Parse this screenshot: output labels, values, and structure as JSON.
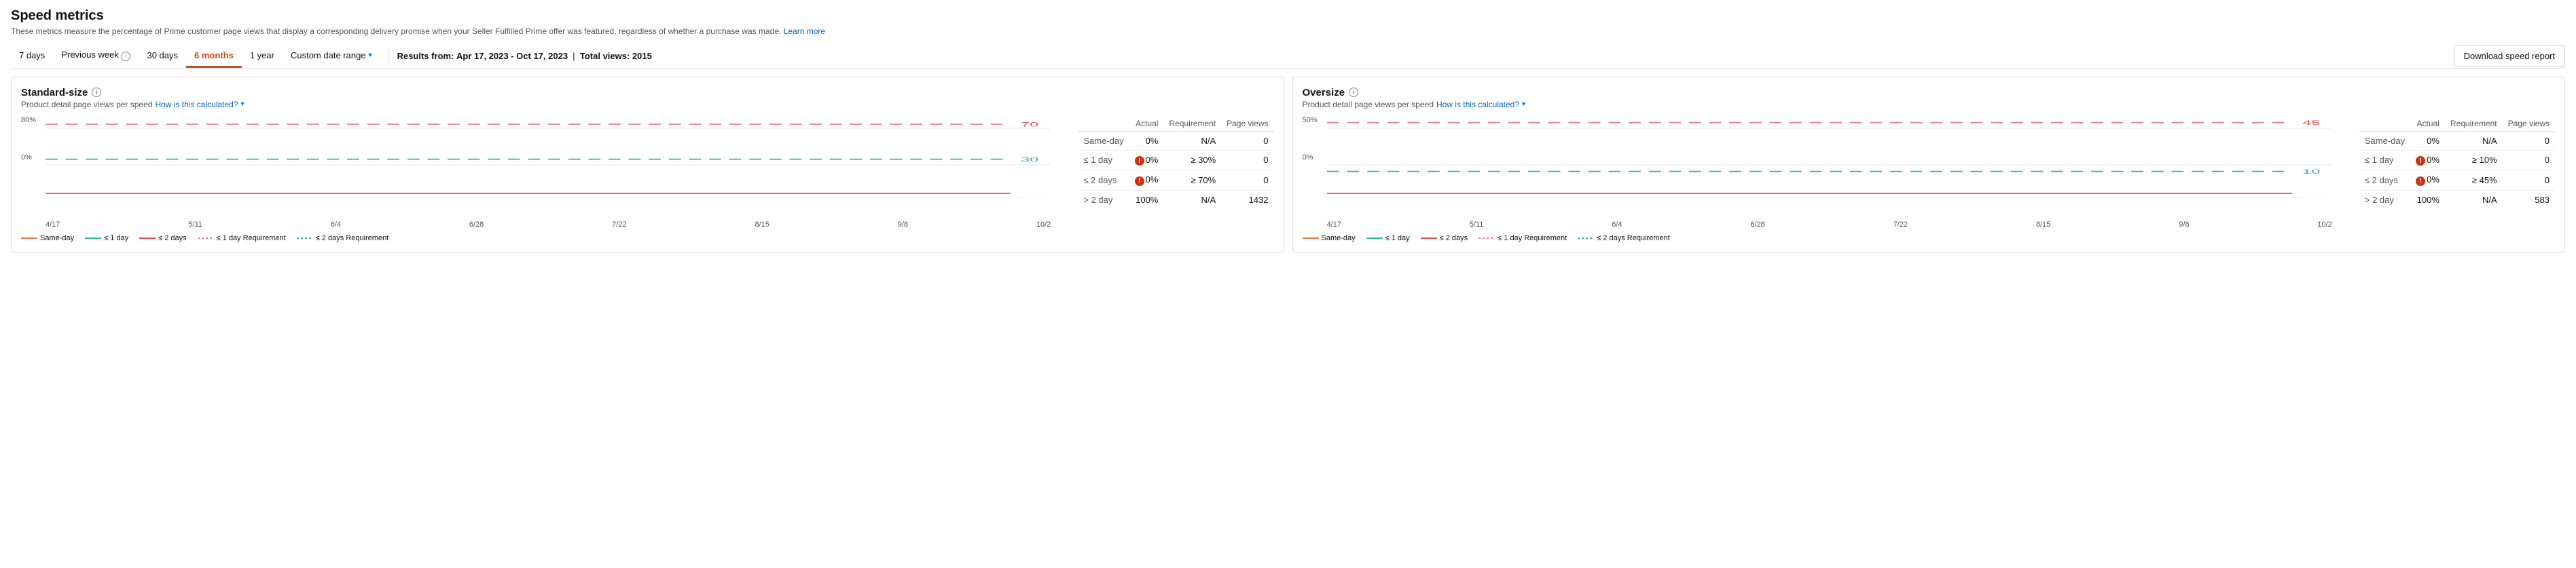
{
  "page": {
    "title": "Speed metrics",
    "subtitle": "These metrics measure the percentage of Prime customer page views that display a corresponding delivery promise when your Seller Fulfilled Prime offer was featured, regardless of whether a purchase was made.",
    "subtitle_link_text": "Learn more",
    "download_btn": "Download speed report"
  },
  "toolbar": {
    "time_buttons": [
      {
        "label": "7 days",
        "active": false
      },
      {
        "label": "Previous week",
        "active": false,
        "has_info": true
      },
      {
        "label": "30 days",
        "active": false
      },
      {
        "label": "6 months",
        "active": true
      },
      {
        "label": "1 year",
        "active": false
      },
      {
        "label": "Custom date range",
        "active": false,
        "has_chevron": true
      }
    ],
    "results_from_label": "Results from:",
    "results_from_value": "Apr 17, 2023 - Oct 17, 2023",
    "total_views_label": "Total views:",
    "total_views_value": "2015"
  },
  "standard_panel": {
    "title": "Standard-size",
    "subtitle": "Product detail page views per speed",
    "subtitle_link": "How is this calculated?",
    "chart": {
      "y_labels": [
        "80%",
        "0%"
      ],
      "x_labels": [
        "4/17",
        "5/11",
        "6/4",
        "6/28",
        "7/22",
        "8/15",
        "9/8",
        "10/2"
      ],
      "ref_lines": [
        {
          "label": "70",
          "value": 70,
          "color": "#e05050",
          "dashed": true
        },
        {
          "label": "30",
          "value": 30,
          "color": "#2db6a3",
          "dashed": true
        }
      ]
    },
    "legend": [
      {
        "label": "Same-day",
        "style": "orange-solid"
      },
      {
        "label": "≤ 1 day",
        "style": "teal-solid"
      },
      {
        "label": "≤ 2 days",
        "style": "red-solid"
      },
      {
        "label": "≤ 1 day Requirement",
        "style": "pink-dashed"
      },
      {
        "label": "≤ 2 days Requirement",
        "style": "teal-dashed"
      }
    ],
    "table": {
      "headers": [
        "",
        "Actual",
        "Requirement",
        "Page views"
      ],
      "rows": [
        {
          "label": "Same-day",
          "actual": "0%",
          "actual_error": false,
          "requirement": "N/A",
          "page_views": "0"
        },
        {
          "label": "≤ 1 day",
          "actual": "0%",
          "actual_error": true,
          "requirement": "≥ 30%",
          "page_views": "0"
        },
        {
          "label": "≤ 2 days",
          "actual": "0%",
          "actual_error": true,
          "requirement": "≥ 70%",
          "page_views": "0"
        },
        {
          "label": "> 2 day",
          "actual": "100%",
          "actual_error": false,
          "requirement": "N/A",
          "page_views": "1432"
        }
      ]
    }
  },
  "oversize_panel": {
    "title": "Oversize",
    "subtitle": "Product detail page views per speed",
    "subtitle_link": "How is this calculated?",
    "chart": {
      "y_labels": [
        "50%",
        "0%"
      ],
      "x_labels": [
        "4/17",
        "5/11",
        "6/4",
        "6/28",
        "7/22",
        "8/15",
        "9/8",
        "10/2"
      ],
      "ref_lines": [
        {
          "label": "45",
          "value": 45,
          "color": "#e05050",
          "dashed": true
        },
        {
          "label": "10",
          "value": 10,
          "color": "#2db6a3",
          "dashed": true
        }
      ]
    },
    "legend": [
      {
        "label": "Same-day",
        "style": "orange-solid"
      },
      {
        "label": "≤ 1 day",
        "style": "teal-solid"
      },
      {
        "label": "≤ 2 days",
        "style": "red-solid"
      },
      {
        "label": "≤ 1 day Requirement",
        "style": "pink-dashed"
      },
      {
        "label": "≤ 2 days Requirement",
        "style": "teal-dashed"
      }
    ],
    "table": {
      "headers": [
        "",
        "Actual",
        "Requirement",
        "Page views"
      ],
      "rows": [
        {
          "label": "Same-day",
          "actual": "0%",
          "actual_error": false,
          "requirement": "N/A",
          "page_views": "0"
        },
        {
          "label": "≤ 1 day",
          "actual": "0%",
          "actual_error": true,
          "requirement": "≥ 10%",
          "page_views": "0"
        },
        {
          "label": "≤ 2 days",
          "actual": "0%",
          "actual_error": true,
          "requirement": "≥ 45%",
          "page_views": "0"
        },
        {
          "label": "> 2 day",
          "actual": "100%",
          "actual_error": false,
          "requirement": "N/A",
          "page_views": "583"
        }
      ]
    }
  }
}
